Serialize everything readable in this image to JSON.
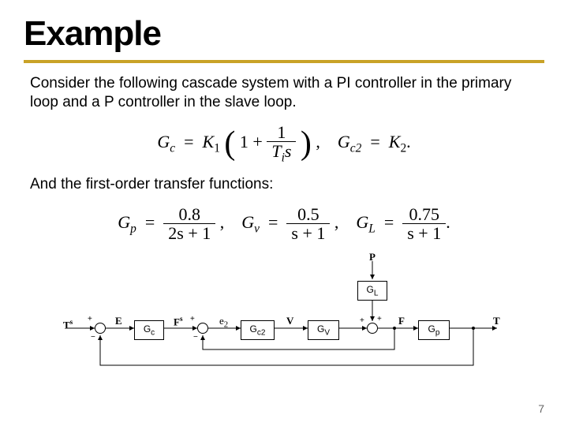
{
  "title": "Example",
  "para1": "Consider the following cascade system with a PI controller in the primary loop and a P controller in the slave loop.",
  "para2": "And the first-order transfer functions:",
  "eq1": {
    "Gc_lhs": "G",
    "Gc_sub": "c",
    "K1": "K",
    "K1_sub": "1",
    "one": "1",
    "Ti": "T",
    "Ti_sub": "i",
    "s": "s",
    "Gc2_lhs": "G",
    "Gc2_sub": "c2",
    "K2": "K",
    "K2_sub": "2"
  },
  "eq2": {
    "Gp_label": "G",
    "Gp_sub": "p",
    "Gp_num": "0.8",
    "Gp_den": "2s + 1",
    "Gv_label": "G",
    "Gv_sub": "v",
    "Gv_num": "0.5",
    "Gv_den": "s + 1",
    "GL_label": "G",
    "GL_sub": "L",
    "GL_num": "0.75",
    "GL_den": "s + 1"
  },
  "diagram": {
    "P": "P",
    "GL": "G<sub>L</sub>",
    "Ts": "T",
    "Ts_sup": "s",
    "E": "E",
    "Gc": "G<sub>c</sub>",
    "Fs": "F",
    "Fs_sup": "s",
    "e2": "e<sub>2</sub>",
    "Gc2": "G<sub>c2</sub>",
    "V": "V",
    "Gv": "G<sub>V</sub>",
    "F": "F",
    "Gp": "G<sub>p</sub>",
    "T": "T",
    "plus": "+",
    "minus": "−"
  },
  "pagenum": "7",
  "chart_data": {
    "type": "block-diagram",
    "description": "Cascade control loop with outer PI controller and inner P controller",
    "blocks": [
      {
        "name": "Gc",
        "tf": "K1*(1 + 1/(Ti*s))"
      },
      {
        "name": "Gc2",
        "tf": "K2"
      },
      {
        "name": "Gv",
        "tf": "0.5/(s+1)"
      },
      {
        "name": "GL",
        "tf": "0.75/(s+1)"
      },
      {
        "name": "Gp",
        "tf": "0.8/(2*s+1)"
      }
    ],
    "signals": [
      "T^s",
      "E",
      "F^s",
      "e2",
      "V",
      "F",
      "T",
      "P"
    ],
    "summing_junctions": [
      {
        "inputs": [
          "T^s (+)",
          "T (−)"
        ],
        "output": "E"
      },
      {
        "inputs": [
          "F^s (+)",
          "F (−)"
        ],
        "output": "e2"
      },
      {
        "inputs": [
          "Gv*e2 (+)",
          "GL*P (+)"
        ],
        "output": "F"
      }
    ],
    "flow": "T^s → [sum1] → E → Gc → F^s → [sum2] → e2 → Gc2 → V → Gv → [sum3] ← GL ← P ; [sum3] → F → Gp → T ; T feeds back to sum1 (outer) ; F feeds back to sum2 (inner)"
  }
}
